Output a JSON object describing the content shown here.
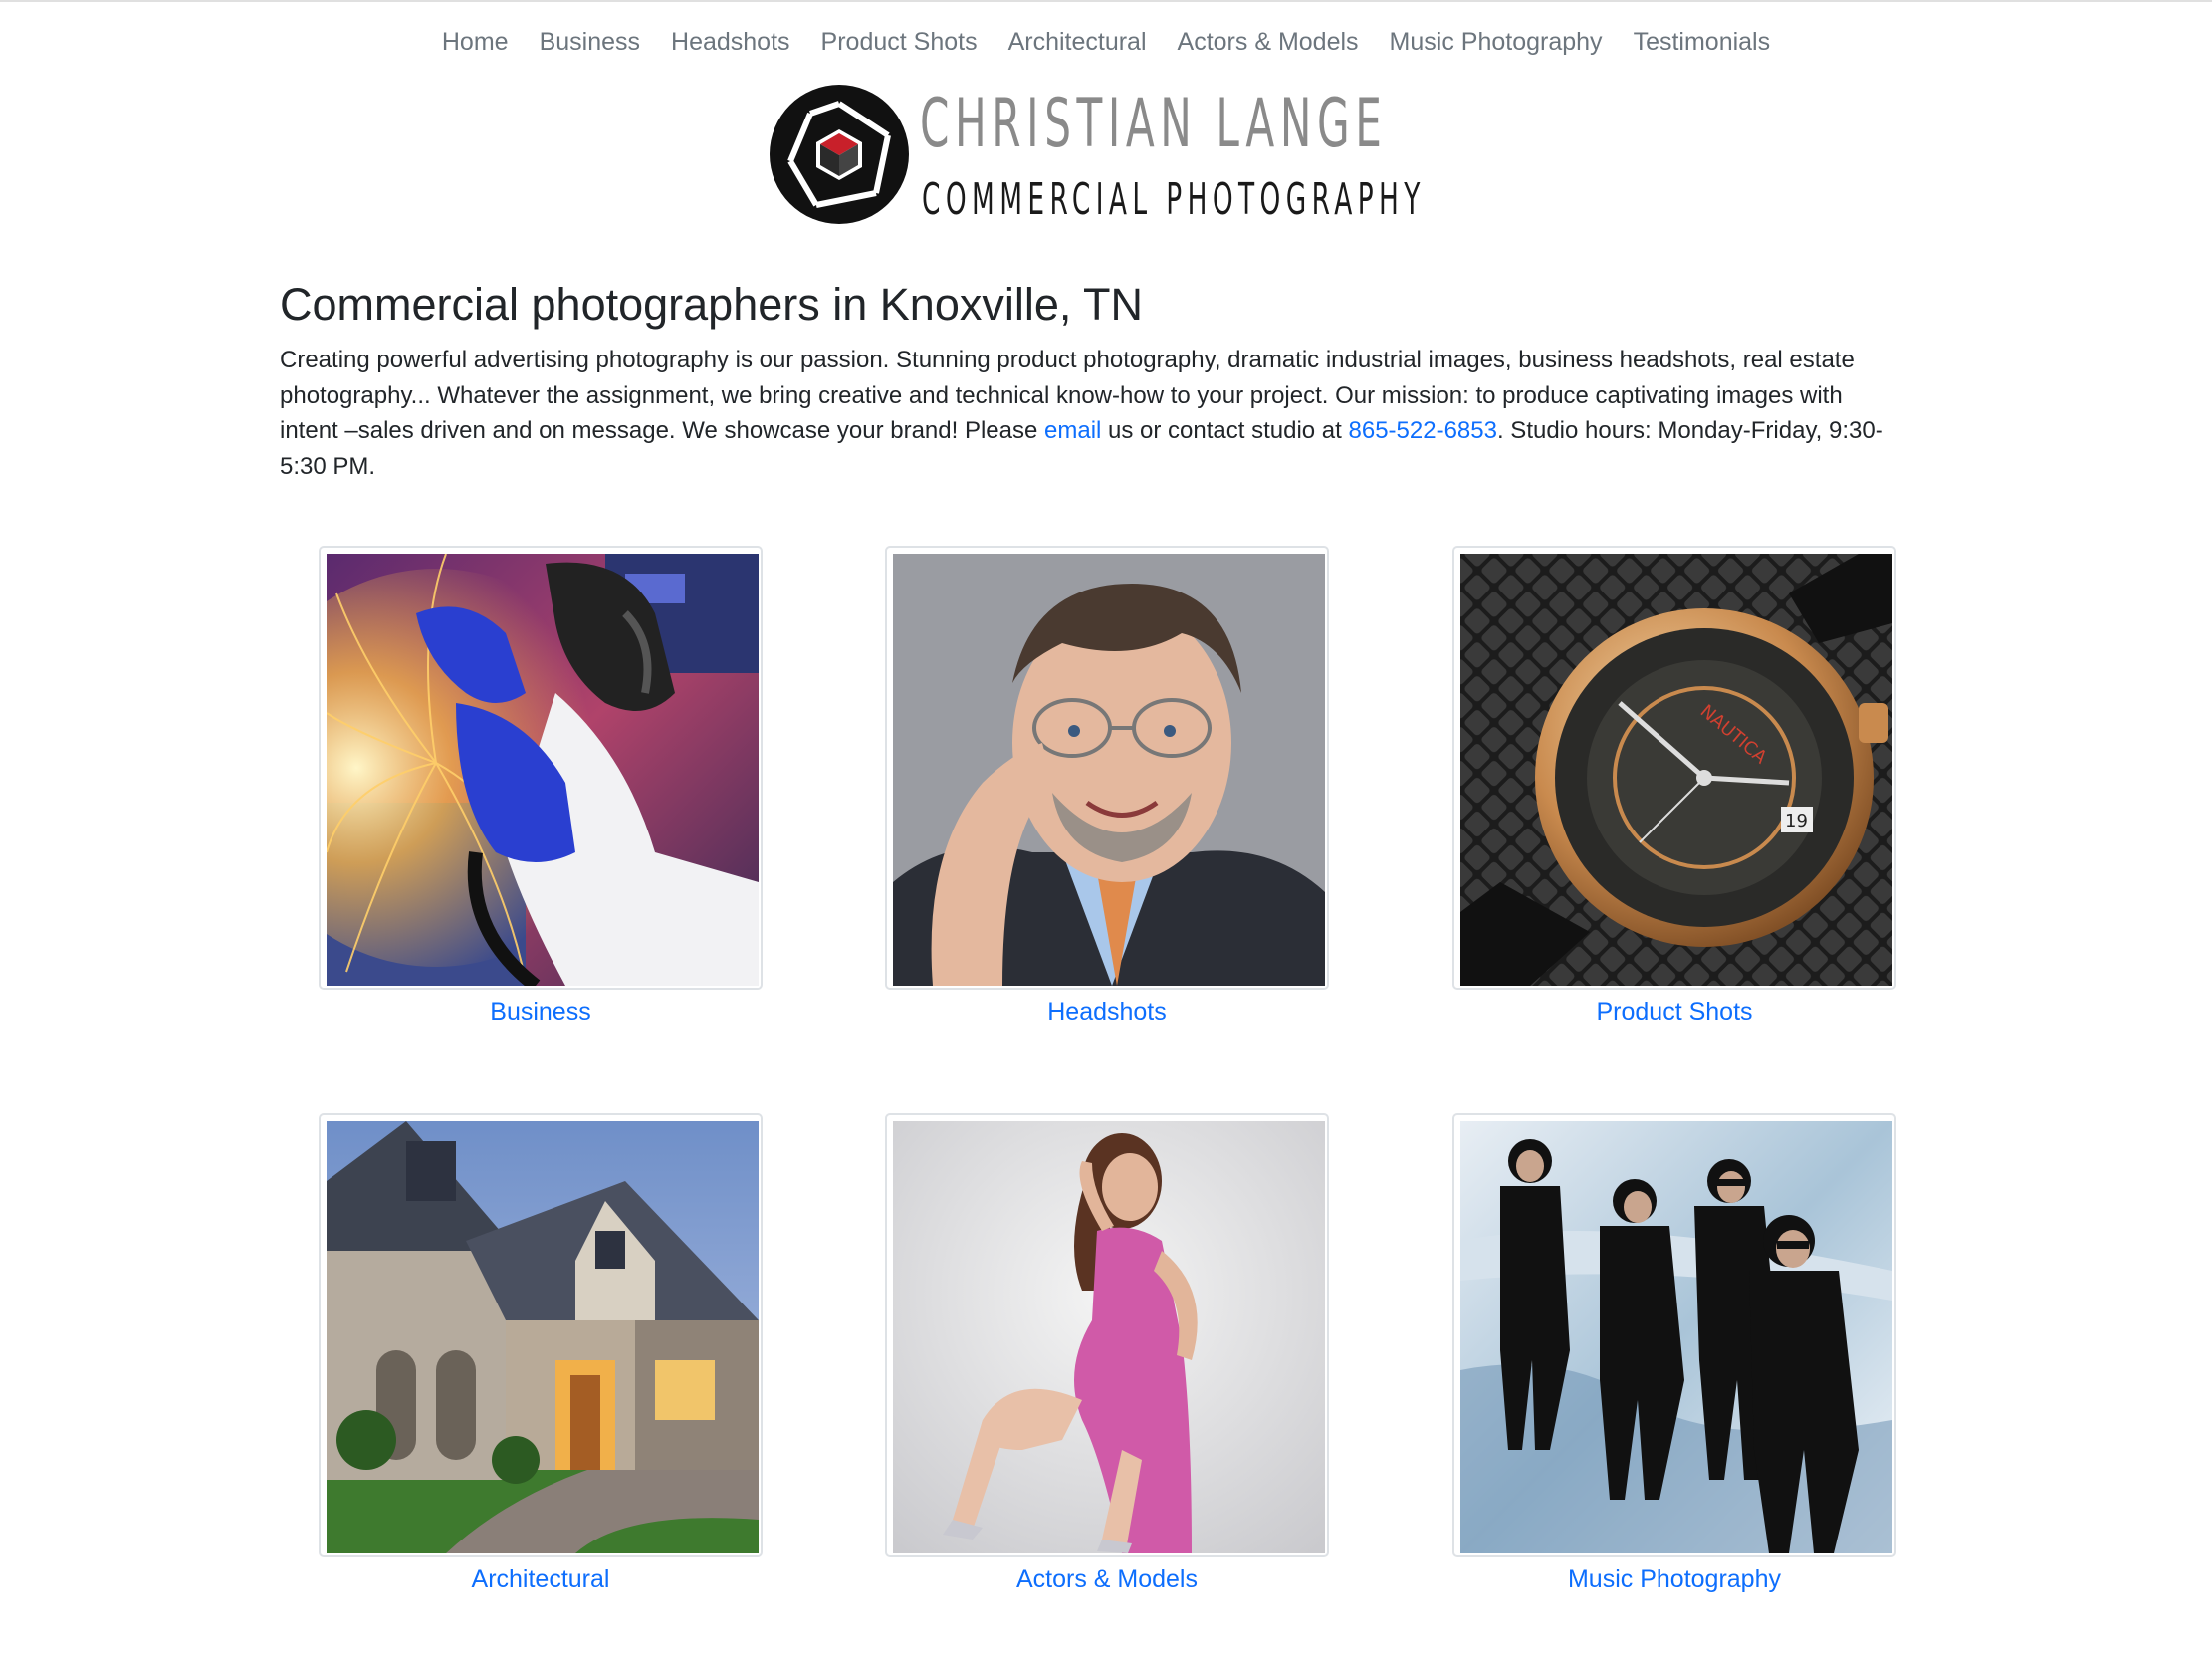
{
  "nav": {
    "items": [
      "Home",
      "Business",
      "Headshots",
      "Product Shots",
      "Architectural",
      "Actors & Models",
      "Music Photography",
      "Testimonials"
    ]
  },
  "logo": {
    "name": "CHRISTIAN LANGE",
    "subtitle": "COMMERCIAL PHOTOGRAPHY"
  },
  "main": {
    "title": "Commercial photographers in Knoxville, TN",
    "intro_1": "Creating powerful advertising photography is our passion. Stunning product photography, dramatic industrial images, business headshots, real estate photography... Whatever the assignment, we bring creative and technical know-how to your project. Our mission: to produce captivating images with intent –sales driven and on message. We showcase your brand! Please ",
    "email_link": "email",
    "intro_2": " us or contact studio at ",
    "phone_link": "865-522-6853",
    "intro_3": ". Studio hours: Monday-Friday, 9:30-5:30 PM."
  },
  "gallery": [
    {
      "label": "Business"
    },
    {
      "label": "Headshots"
    },
    {
      "label": "Product Shots"
    },
    {
      "label": "Architectural"
    },
    {
      "label": "Actors & Models"
    },
    {
      "label": "Music Photography"
    }
  ],
  "colors": {
    "link": "#0d6efd",
    "nav_text": "#6c757d",
    "logo_red": "#c8202a"
  },
  "watch_text": {
    "brand": "NAUTICA",
    "date": "19"
  }
}
